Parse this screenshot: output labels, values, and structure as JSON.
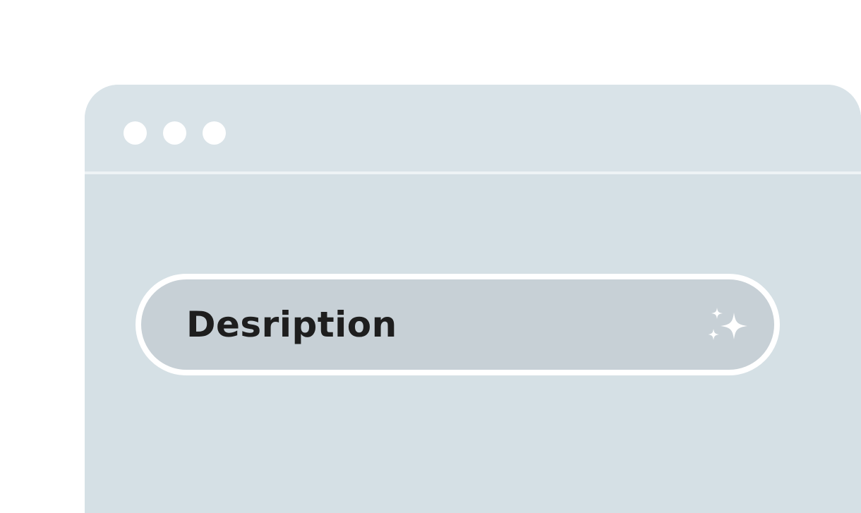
{
  "window": {
    "controls": [
      "dot-1",
      "dot-2",
      "dot-3"
    ],
    "colors": {
      "window_bg": "#d5e0e5",
      "titlebar_bg": "#d9e3e8",
      "field_bg": "#c7d0d6",
      "field_border": "#ffffff",
      "text": "#1e1e1e"
    }
  },
  "field": {
    "label": "Desription",
    "icon": "sparkle-icon"
  }
}
